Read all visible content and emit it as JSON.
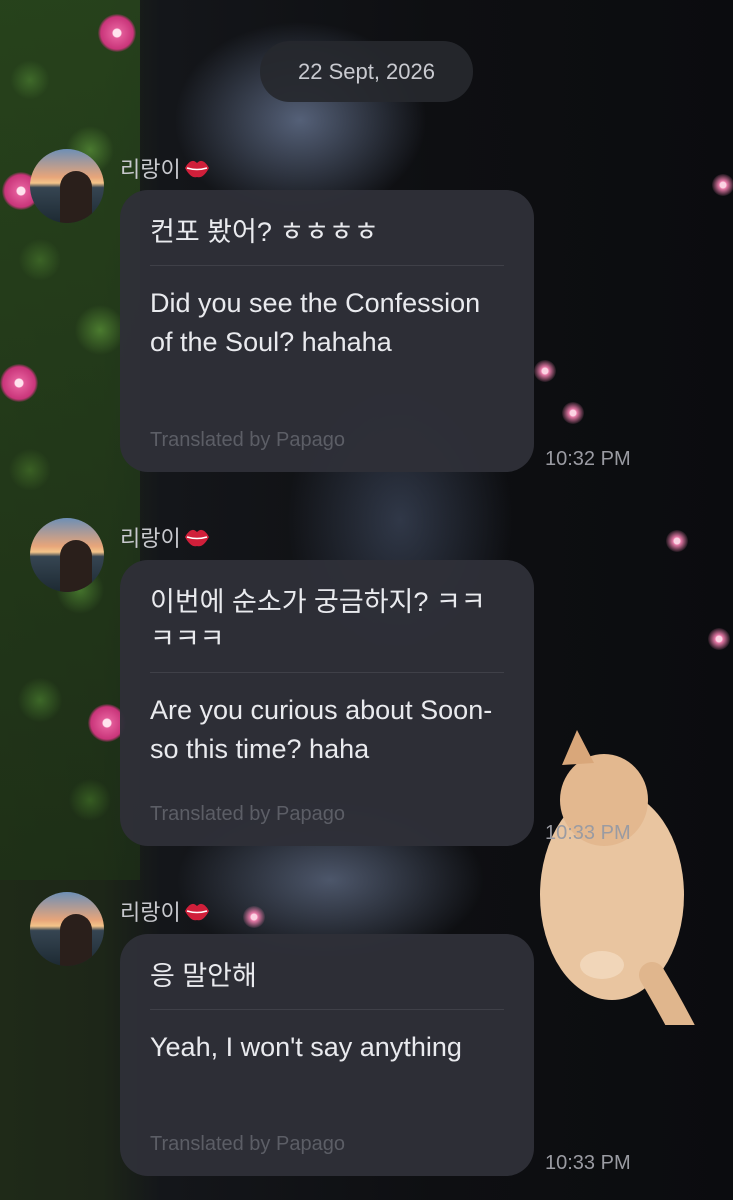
{
  "date_label": "22 Sept, 2026",
  "colors": {
    "bubble": "#2e3038",
    "text": "#e9eaee",
    "credit": "#5c5e66",
    "lips": "#d01f3a"
  },
  "messages": [
    {
      "sender": "리랑이",
      "sender_icon": "lips-icon",
      "original": "컨포 봤어? ㅎㅎㅎㅎ",
      "translation": "Did you see the Confession of the Soul? hahaha",
      "credit": "Translated by Papago",
      "time": "10:32 PM"
    },
    {
      "sender": "리랑이",
      "sender_icon": "lips-icon",
      "original": "이번에 순소가 궁금하지? ㅋㅋㅋㅋㅋ",
      "translation": "Are you curious about Soon-so this time? haha",
      "credit": "Translated by Papago",
      "time": "10:33 PM"
    },
    {
      "sender": "리랑이",
      "sender_icon": "lips-icon",
      "original": "응 말안해",
      "translation": "Yeah, I won't say anything",
      "credit": "Translated by Papago",
      "time": "10:33 PM"
    }
  ]
}
